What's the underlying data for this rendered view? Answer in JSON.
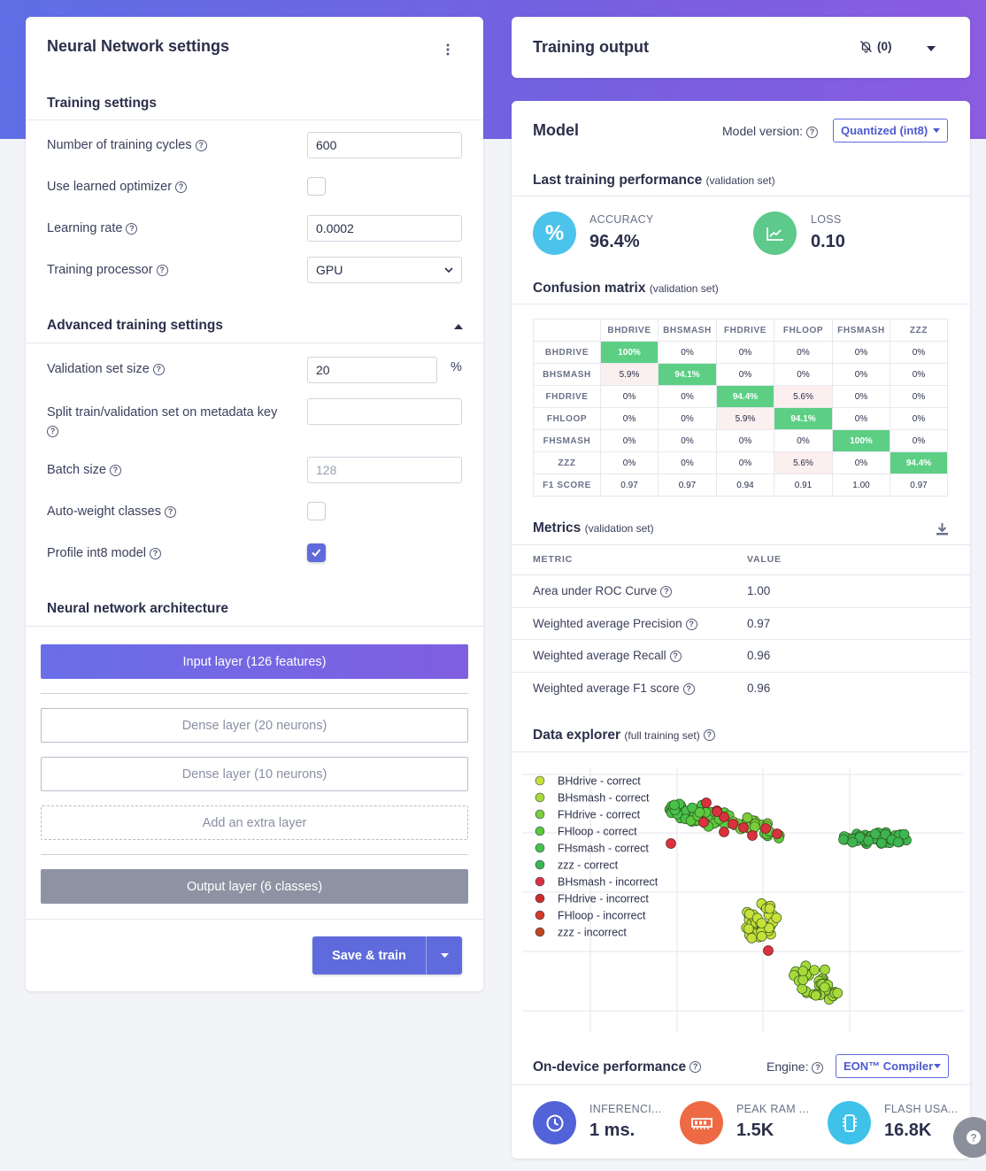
{
  "left_panel": {
    "title": "Neural Network settings",
    "training_settings": {
      "heading": "Training settings",
      "cycles_label": "Number of training cycles",
      "cycles_value": "600",
      "optimizer_label": "Use learned optimizer",
      "optimizer_checked": false,
      "lr_label": "Learning rate",
      "lr_value": "0.0002",
      "processor_label": "Training processor",
      "processor_value": "GPU"
    },
    "advanced": {
      "heading": "Advanced training settings",
      "val_size_label": "Validation set size",
      "val_size_value": "20",
      "val_size_unit": "%",
      "split_label": "Split train/validation set on metadata key",
      "split_value": "",
      "batch_label": "Batch size",
      "batch_placeholder": "128",
      "autoweight_label": "Auto-weight classes",
      "autoweight_checked": false,
      "profile_label": "Profile int8 model",
      "profile_checked": true
    },
    "architecture": {
      "heading": "Neural network architecture",
      "input_layer": "Input layer (126 features)",
      "dense1": "Dense layer (20 neurons)",
      "dense2": "Dense layer (10 neurons)",
      "add_layer": "Add an extra layer",
      "output_layer": "Output layer (6 classes)"
    },
    "save_train": "Save & train"
  },
  "training_output": {
    "title": "Training output",
    "notif_count": "(0)"
  },
  "model": {
    "title": "Model",
    "version_label": "Model version:",
    "version_value": "Quantized (int8)",
    "last_perf_title": "Last training performance",
    "last_perf_sub": "(validation set)",
    "accuracy_label": "ACCURACY",
    "accuracy_value": "96.4%",
    "loss_label": "LOSS",
    "loss_value": "0.10",
    "cm_title": "Confusion matrix",
    "cm_sub": "(validation set)",
    "confusion_matrix": {
      "columns": [
        "BHDRIVE",
        "BHSMASH",
        "FHDRIVE",
        "FHLOOP",
        "FHSMASH",
        "ZZZ"
      ],
      "rows": [
        {
          "label": "BHDRIVE",
          "cells": [
            "100%",
            "0%",
            "0%",
            "0%",
            "0%",
            "0%"
          ]
        },
        {
          "label": "BHSMASH",
          "cells": [
            "5.9%",
            "94.1%",
            "0%",
            "0%",
            "0%",
            "0%"
          ]
        },
        {
          "label": "FHDRIVE",
          "cells": [
            "0%",
            "0%",
            "94.4%",
            "5.6%",
            "0%",
            "0%"
          ]
        },
        {
          "label": "FHLOOP",
          "cells": [
            "0%",
            "0%",
            "5.9%",
            "94.1%",
            "0%",
            "0%"
          ]
        },
        {
          "label": "FHSMASH",
          "cells": [
            "0%",
            "0%",
            "0%",
            "0%",
            "100%",
            "0%"
          ]
        },
        {
          "label": "ZZZ",
          "cells": [
            "0%",
            "0%",
            "0%",
            "5.6%",
            "0%",
            "94.4%"
          ]
        }
      ],
      "f1_label": "F1 SCORE",
      "f1": [
        "0.97",
        "0.97",
        "0.94",
        "0.91",
        "1.00",
        "0.97"
      ]
    },
    "metrics_title": "Metrics",
    "metrics_sub": "(validation set)",
    "metrics_col_metric": "METRIC",
    "metrics_col_value": "VALUE",
    "metrics": [
      {
        "name": "Area under ROC Curve",
        "value": "1.00"
      },
      {
        "name": "Weighted average Precision",
        "value": "0.97"
      },
      {
        "name": "Weighted average Recall",
        "value": "0.96"
      },
      {
        "name": "Weighted average F1 score",
        "value": "0.96"
      }
    ],
    "explorer_title": "Data explorer",
    "explorer_sub": "(full training set)",
    "legend": [
      {
        "label": "BHdrive - correct",
        "color": "#c9df3a"
      },
      {
        "label": "BHsmash - correct",
        "color": "#a8d93a"
      },
      {
        "label": "FHdrive - correct",
        "color": "#7ccc3c"
      },
      {
        "label": "FHloop - correct",
        "color": "#5cc83e"
      },
      {
        "label": "FHsmash - correct",
        "color": "#48c14a"
      },
      {
        "label": "zzz - correct",
        "color": "#3db552"
      },
      {
        "label": "BHsmash - incorrect",
        "color": "#d8323e"
      },
      {
        "label": "FHdrive - incorrect",
        "color": "#cc2b2b"
      },
      {
        "label": "FHloop - incorrect",
        "color": "#d43a2a"
      },
      {
        "label": "zzz - incorrect",
        "color": "#c0461f"
      }
    ],
    "ondevice_title": "On-device performance",
    "engine_label": "Engine:",
    "engine_value": "EON™ Compiler",
    "inferencing_label": "INFERENCI...",
    "inferencing_value": "1 ms.",
    "ram_label": "PEAK RAM ...",
    "ram_value": "1.5K",
    "flash_label": "FLASH USA...",
    "flash_value": "16.8K"
  },
  "colors": {
    "accent": "#5f6bdc",
    "success": "#5ccf85",
    "accuracy_circle": "#4cc3ea",
    "loss_circle": "#5dc98a",
    "clock_circle": "#5262d8",
    "ram_circle": "#ee6a44",
    "flash_circle": "#3fc2ea"
  }
}
